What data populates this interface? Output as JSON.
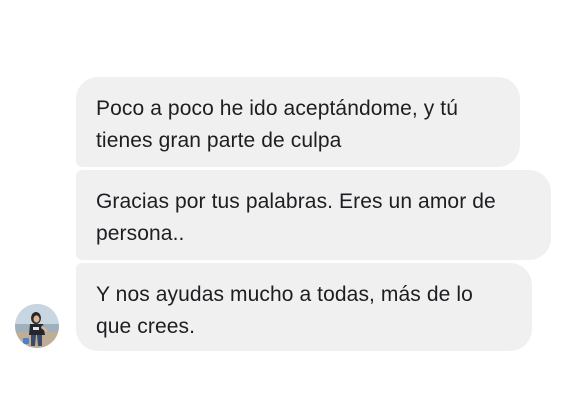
{
  "messages": [
    {
      "text": "Poco a poco he ido aceptándome, y tú tienes gran parte de culpa"
    },
    {
      "text": "Gracias por tus palabras. Eres un amor de persona.."
    },
    {
      "text": "Y nos ayudas mucho a todas, más de lo que crees."
    }
  ],
  "colors": {
    "bubble_background": "#f1f0f0",
    "text": "#1c1e21",
    "page_background": "#ffffff"
  },
  "sender": {
    "avatar_icon": "user-photo-avatar"
  }
}
